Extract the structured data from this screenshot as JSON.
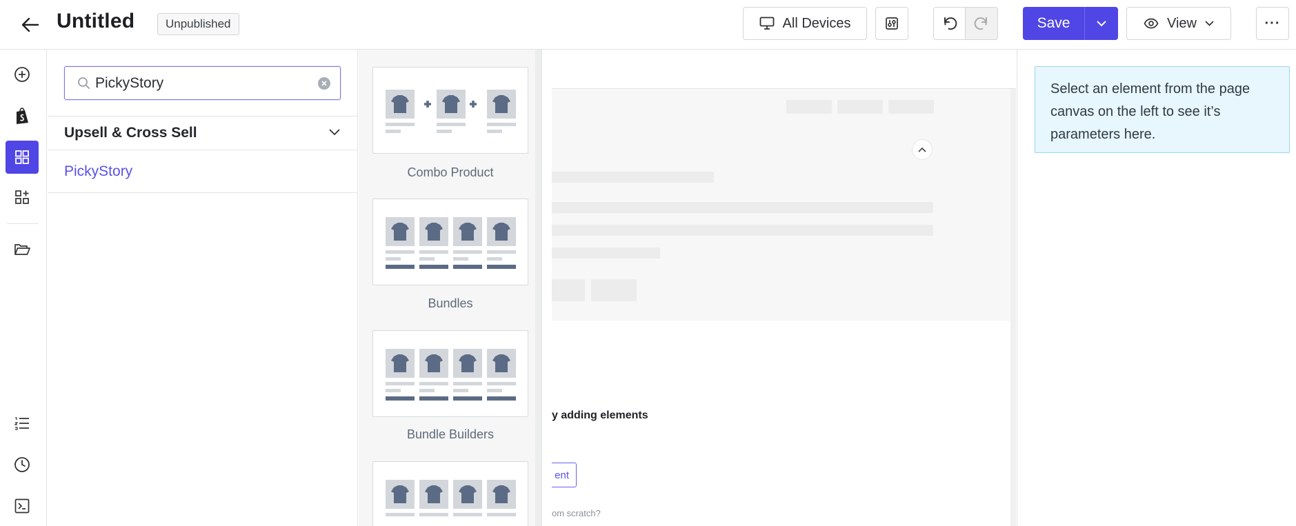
{
  "header": {
    "title": "Untitled",
    "status_badge": "Unpublished",
    "devices_label": "All Devices",
    "save_label": "Save",
    "view_label": "View",
    "more_label": "···"
  },
  "rail": {
    "icons": [
      "add-icon",
      "shopify-icon",
      "elements-grid-icon",
      "apps-add-icon",
      "folder-open-icon",
      "layers-list-icon",
      "history-clock-icon",
      "terminal-icon"
    ]
  },
  "panel": {
    "search": {
      "value": "PickyStory",
      "placeholder": "Search"
    },
    "category": "Upsell & Cross Sell",
    "subitem": "PickyStory"
  },
  "templates": [
    {
      "label": "Combo Product"
    },
    {
      "label": "Bundles"
    },
    {
      "label": "Bundle Builders"
    },
    {
      "label": ""
    }
  ],
  "canvas": {
    "hint_text": "y adding elements",
    "button_text": "ent",
    "scratch_text": "om scratch?"
  },
  "right": {
    "info": "Select an element from the page canvas on the left to see it’s parameters here."
  },
  "colors": {
    "accent": "#5046e5",
    "info_bg": "#e8f6fd",
    "info_border": "#9bd4ee",
    "tee": "#5b6b85"
  }
}
